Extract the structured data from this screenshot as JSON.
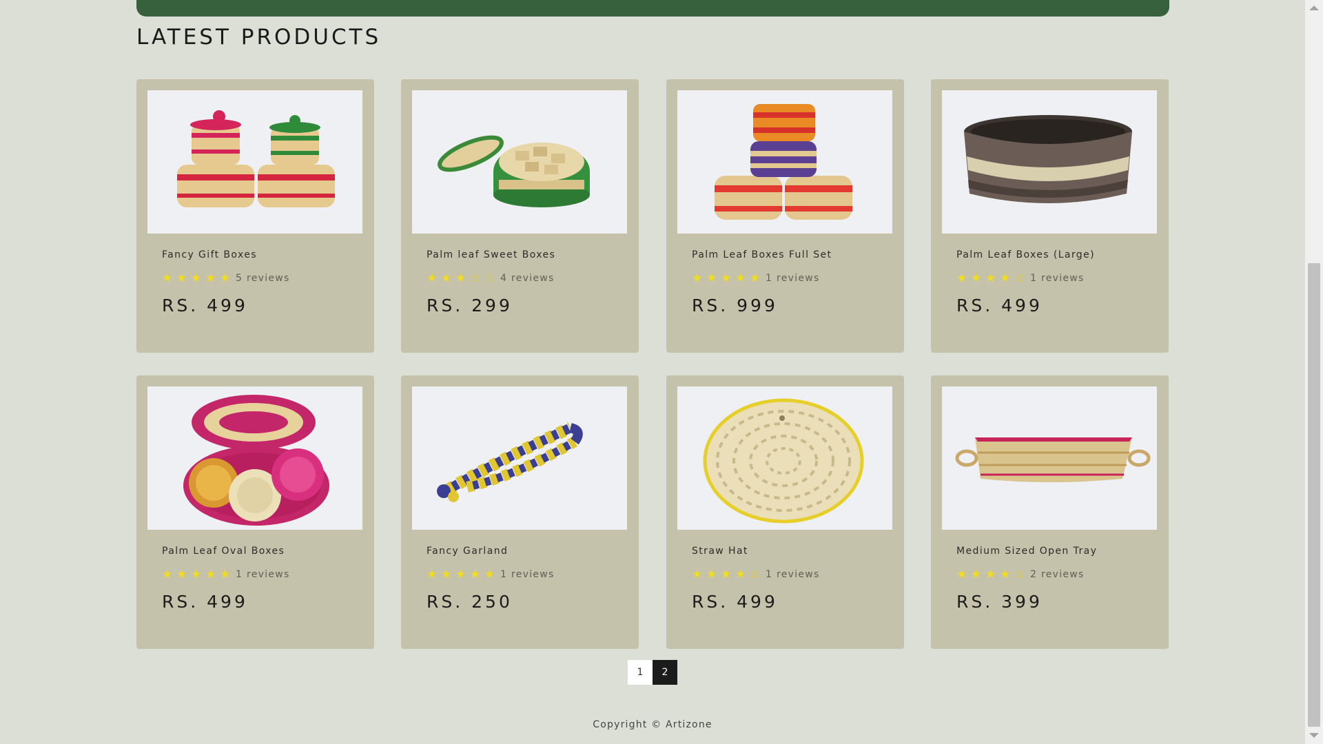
{
  "section": {
    "title": "LATEST PRODUCTS"
  },
  "theme": {
    "accent": "#37603d",
    "card_bg": "#c5c2ab",
    "page_bg": "#dcdfd5",
    "star_color": "#f2dc1f"
  },
  "products": [
    {
      "name": "Fancy Gift Boxes",
      "rating": 5,
      "reviews": "5 reviews",
      "price": "RS. 499",
      "image_icon": "gift-boxes-image"
    },
    {
      "name": "Palm leaf Sweet Boxes",
      "rating": 3,
      "reviews": "4 reviews",
      "price": "RS. 299",
      "image_icon": "sweet-box-image"
    },
    {
      "name": "Palm Leaf Boxes Full Set",
      "rating": 5,
      "reviews": "1 reviews",
      "price": "RS. 999",
      "image_icon": "boxes-full-set-image"
    },
    {
      "name": "Palm Leaf Boxes (Large)",
      "rating": 4,
      "reviews": "1 reviews",
      "price": "RS. 499",
      "image_icon": "large-box-image"
    },
    {
      "name": "Palm Leaf Oval Boxes",
      "rating": 5,
      "reviews": "1 reviews",
      "price": "RS. 499",
      "image_icon": "oval-boxes-image"
    },
    {
      "name": "Fancy Garland",
      "rating": 5,
      "reviews": "1 reviews",
      "price": "RS. 250",
      "image_icon": "garland-image"
    },
    {
      "name": "Straw Hat",
      "rating": 4,
      "reviews": "1 reviews",
      "price": "RS. 499",
      "image_icon": "straw-hat-image"
    },
    {
      "name": "Medium Sized Open Tray",
      "rating": 4,
      "reviews": "2 reviews",
      "price": "RS. 399",
      "image_icon": "open-tray-image"
    }
  ],
  "pagination": {
    "pages": [
      "1",
      "2"
    ],
    "active": "2"
  },
  "footer": {
    "copyright": "Copyright © Artizone"
  }
}
